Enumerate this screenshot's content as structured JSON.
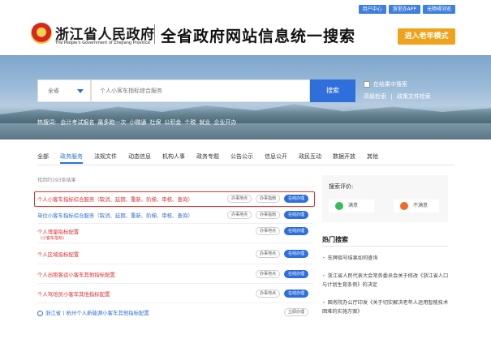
{
  "util": [
    "用户中心",
    "浙里办APP",
    "无障碍浏览"
  ],
  "header": {
    "site_name": "浙江省人民政府",
    "site_name_en": "The People's Government of Zhejiang Province",
    "title": "全省政府网站信息统一搜索",
    "elder_mode": "进入老年模式"
  },
  "search": {
    "scope": "全省",
    "placeholder": "个人小客车指标综合服务",
    "button": "搜索",
    "in_results": "在结果中搜索",
    "advanced": "高级检索",
    "divider": "|",
    "policy_search": "政策文件检索"
  },
  "hot": {
    "label": "热搜词:",
    "words": [
      "会计考试报名",
      "最多跑一次",
      "小微通",
      "社保",
      "公积金",
      "个税",
      "就业",
      "企业开办"
    ]
  },
  "tabs": [
    "全部",
    "政务服务",
    "法规文件",
    "动态信息",
    "机构人事",
    "政务专题",
    "公告公示",
    "信息公开",
    "政民互动",
    "数据开放",
    "其他"
  ],
  "active_tab": "政务服务",
  "found": "找到约193条结果",
  "buttons": {
    "guide_location": "办事地点",
    "guide": "办事指南",
    "online": "在线办理",
    "appointment": "立即办理"
  },
  "results": [
    {
      "title": "个人小客车指标综合服务（取消、延期、重新、阶梯、审核、查询）",
      "color": "red",
      "btns": [
        "办事地点",
        "办事指南",
        "在线办理"
      ]
    },
    {
      "title": "单位小客车指标综合服务（取消、延期、重新、阶梯、审核、查询）",
      "color": "blue",
      "btns": [
        "办事地点",
        "办事指南",
        "在线办理"
      ]
    },
    {
      "title": "个人增量指标配置",
      "sub": "(小客车指标)",
      "color": "red",
      "btns": [
        "办事地点",
        "在线办理"
      ]
    },
    {
      "title": "个人区域指标配置",
      "color": "red",
      "btns": [
        "办事地点",
        "在线办理"
      ]
    },
    {
      "title": "个人出租客运小客车其他指标配置",
      "color": "red",
      "btns": [
        "办事地点",
        "在线办理"
      ]
    },
    {
      "title": "个人驾培员小客车其他指标配置",
      "color": "red",
      "btns": [
        "办事地点",
        "在线办理"
      ]
    },
    {
      "title": "浙江省丨杭州个人新能源小客车其他指标配置",
      "color": "blue",
      "btns": [
        "立即办理"
      ]
    }
  ],
  "rating": {
    "title": "搜索评价:",
    "good": "满意",
    "bad": "不满意"
  },
  "hot_search": {
    "title": "热门搜索",
    "items": [
      "车牌摇号结果如何查询",
      "浙江省人民代表大会常务委员会关于修改《浙江省人口与计划生育条例》的决定",
      "国务院办公厅印发《关于切实解决老年人运用智能技术困难的实施方案》"
    ]
  },
  "colors": {
    "accent": "#2f6fdb",
    "highlight": "#e03131",
    "elder": "#f0a21a"
  }
}
